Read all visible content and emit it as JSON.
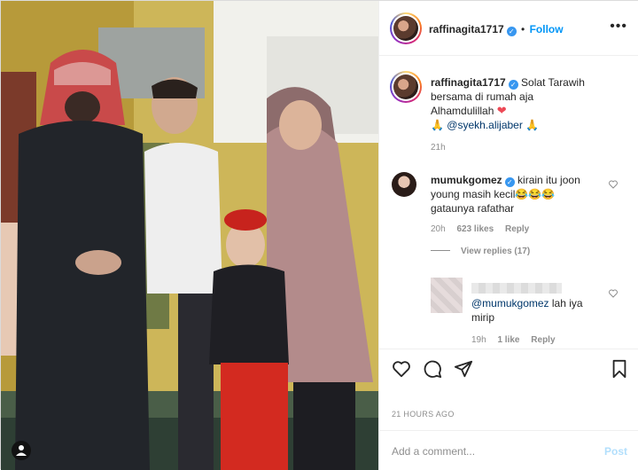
{
  "post": {
    "username": "raffinagita1717",
    "follow_label": "Follow",
    "more_icon": "more-dots-icon",
    "caption_lines": [
      "Solat Tarawih",
      "bersama di rumah aja",
      "Alhamdulillah"
    ],
    "caption_mention": "@syekh.alijaber",
    "caption_age": "21h",
    "timestamp": "21 HOURS AGO"
  },
  "comments": [
    {
      "username": "mumukgomez",
      "lines": [
        "kirain itu joon",
        "young masih kecil",
        "gataunya rafathar"
      ],
      "age": "20h",
      "likes": "623 likes",
      "reply_label": "Reply",
      "view_replies": "View replies (17)"
    },
    {
      "username": "",
      "mention": "@mumukgomez",
      "text": "lah iya",
      "text2": "mirip",
      "age": "19h",
      "likes": "1 like",
      "reply_label": "Reply"
    }
  ],
  "actions": {
    "like_icon": "heart-icon",
    "comment_icon": "comment-icon",
    "share_icon": "share-icon",
    "save_icon": "bookmark-icon"
  },
  "add_comment": {
    "placeholder": "Add a comment...",
    "post_label": "Post"
  },
  "colors": {
    "accent": "#0095f6",
    "verified": "#3897f0",
    "post_disabled": "#b2dffc",
    "heart_red": "#ed4956"
  }
}
